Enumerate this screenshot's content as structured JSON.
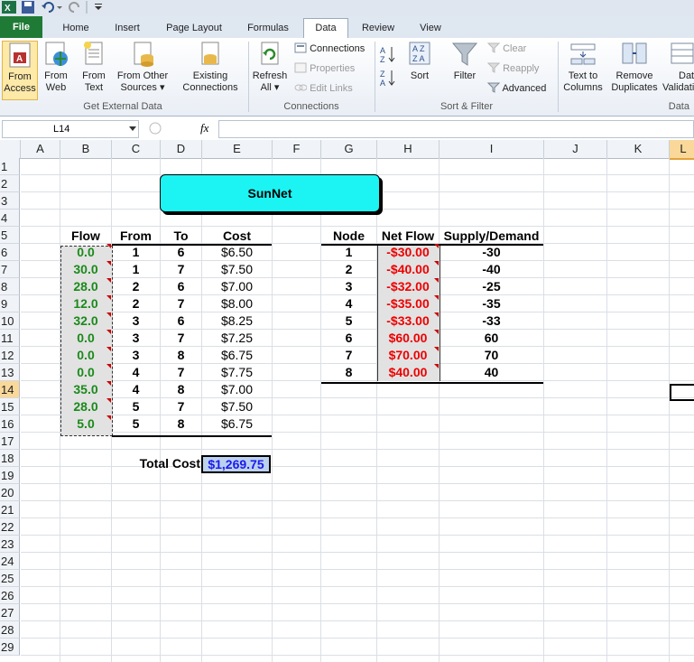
{
  "window": {
    "quick_access_icons": [
      "excel-icon",
      "save-icon",
      "undo-icon",
      "redo-icon",
      "customize-icon"
    ]
  },
  "tabs": [
    "File",
    "Home",
    "Insert",
    "Page Layout",
    "Formulas",
    "Data",
    "Review",
    "View"
  ],
  "active_tab": "Data",
  "ribbon": {
    "get_external_data": {
      "label": "Get External Data",
      "from_access_1": "From",
      "from_access_2": "Access",
      "from_web_1": "From",
      "from_web_2": "Web",
      "from_text_1": "From",
      "from_text_2": "Text",
      "from_other_1": "From Other",
      "from_other_2": "Sources ▾",
      "existing_1": "Existing",
      "existing_2": "Connections"
    },
    "connections": {
      "label": "Connections",
      "refresh_1": "Refresh",
      "refresh_2": "All ▾",
      "connections": "Connections",
      "properties": "Properties",
      "edit_links": "Edit Links"
    },
    "sort_filter": {
      "label": "Sort & Filter",
      "sort": "Sort",
      "filter": "Filter",
      "clear": "Clear",
      "reapply": "Reapply",
      "advanced": "Advanced"
    },
    "data_tools": {
      "label": "Data",
      "text_to_columns_1": "Text to",
      "text_to_columns_2": "Columns",
      "remove_duplicates_1": "Remove",
      "remove_duplicates_2": "Duplicates",
      "data_validation_1": "Dat",
      "data_validation_2": "Validati"
    }
  },
  "formula_bar": {
    "name_box": "L14",
    "fx": "fx",
    "formula": ""
  },
  "columns": [
    "A",
    "B",
    "C",
    "D",
    "E",
    "F",
    "G",
    "H",
    "I",
    "J",
    "K"
  ],
  "selected_column": "L",
  "rows": [
    "1",
    "2",
    "3",
    "4",
    "5",
    "6",
    "7",
    "8",
    "9",
    "10",
    "11",
    "12",
    "13",
    "14",
    "15",
    "16",
    "17",
    "18",
    "19",
    "20",
    "21",
    "22",
    "23",
    "24",
    "25",
    "26",
    "27",
    "28",
    "29"
  ],
  "selected_row": "14",
  "sheet": {
    "title": "SunNet",
    "arcs_headers": {
      "flow": "Flow",
      "from": "From",
      "to": "To",
      "cost": "Cost"
    },
    "arcs": [
      {
        "flow": "0.0",
        "from": "1",
        "to": "6",
        "cost": "$6.50"
      },
      {
        "flow": "30.0",
        "from": "1",
        "to": "7",
        "cost": "$7.50"
      },
      {
        "flow": "28.0",
        "from": "2",
        "to": "6",
        "cost": "$7.00"
      },
      {
        "flow": "12.0",
        "from": "2",
        "to": "7",
        "cost": "$8.00"
      },
      {
        "flow": "32.0",
        "from": "3",
        "to": "6",
        "cost": "$8.25"
      },
      {
        "flow": "0.0",
        "from": "3",
        "to": "7",
        "cost": "$7.25"
      },
      {
        "flow": "0.0",
        "from": "3",
        "to": "8",
        "cost": "$6.75"
      },
      {
        "flow": "0.0",
        "from": "4",
        "to": "7",
        "cost": "$7.75"
      },
      {
        "flow": "35.0",
        "from": "4",
        "to": "8",
        "cost": "$7.00"
      },
      {
        "flow": "28.0",
        "from": "5",
        "to": "7",
        "cost": "$7.50"
      },
      {
        "flow": "5.0",
        "from": "5",
        "to": "8",
        "cost": "$6.75"
      }
    ],
    "nodes_headers": {
      "node": "Node",
      "net_flow": "Net Flow",
      "supply_demand": "Supply/Demand"
    },
    "nodes": [
      {
        "node": "1",
        "net_flow": "-$30.00",
        "supply_demand": "-30"
      },
      {
        "node": "2",
        "net_flow": "-$40.00",
        "supply_demand": "-40"
      },
      {
        "node": "3",
        "net_flow": "-$32.00",
        "supply_demand": "-25"
      },
      {
        "node": "4",
        "net_flow": "-$35.00",
        "supply_demand": "-35"
      },
      {
        "node": "5",
        "net_flow": "-$33.00",
        "supply_demand": "-33"
      },
      {
        "node": "6",
        "net_flow": "$60.00",
        "supply_demand": "60"
      },
      {
        "node": "7",
        "net_flow": "$70.00",
        "supply_demand": "70"
      },
      {
        "node": "8",
        "net_flow": "$40.00",
        "supply_demand": "40"
      }
    ],
    "total_cost_label": "Total Cost",
    "total_cost": "$1,269.75"
  },
  "colors": {
    "title_fill": "#1cf4f4",
    "flow_text": "#1a8a1a",
    "net_flow_text": "#ee0000",
    "total_text": "#1a1af0",
    "total_fill": "#bcd1ee",
    "file_tab": "#1f7a35"
  }
}
